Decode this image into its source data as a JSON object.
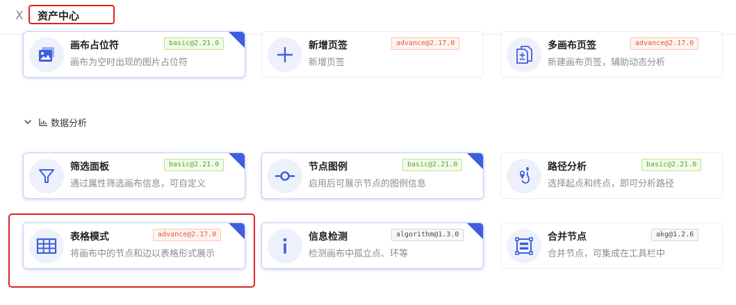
{
  "header": {
    "close_symbol": "X",
    "title": "资产中心"
  },
  "accent_color": "#3e5ee0",
  "section": {
    "label": "数据分析"
  },
  "cards": [
    {
      "title": "画布占位符",
      "badge": "basic@2.21.0",
      "desc": "画布为空时出现的图片占位符",
      "icon": "image-placeholder-icon",
      "selected": true
    },
    {
      "title": "新增页签",
      "badge": "advance@2.17.0",
      "desc": "新增页签",
      "icon": "plus-icon",
      "selected": false
    },
    {
      "title": "多画布页签",
      "badge": "advance@2.17.0",
      "desc": "新建画布页签，辅助动态分析",
      "icon": "multi-canvas-icon",
      "selected": false
    },
    {
      "title": "筛选面板",
      "badge": "basic@2.21.0",
      "desc": "通过属性筛选画布信息，可自定义",
      "icon": "filter-icon",
      "selected": true
    },
    {
      "title": "节点图例",
      "badge": "basic@2.21.0",
      "desc": "启用后可展示节点的图例信息",
      "icon": "node-legend-icon",
      "selected": true
    },
    {
      "title": "路径分析",
      "badge": "basic@2.21.0",
      "desc": "选择起点和终点，即可分析路径",
      "icon": "path-analysis-icon",
      "selected": false
    },
    {
      "title": "表格模式",
      "badge": "advance@2.17.0",
      "desc": "将画布中的节点和边以表格形式展示",
      "icon": "table-icon",
      "selected": true
    },
    {
      "title": "信息检测",
      "badge": "algorithm@1.3.0",
      "desc": "检测画布中孤立点、环等",
      "icon": "info-icon",
      "selected": true
    },
    {
      "title": "合并节点",
      "badge": "akg@1.2.6",
      "desc": "合并节点，可集成在工具栏中",
      "icon": "merge-nodes-icon",
      "selected": false
    }
  ]
}
